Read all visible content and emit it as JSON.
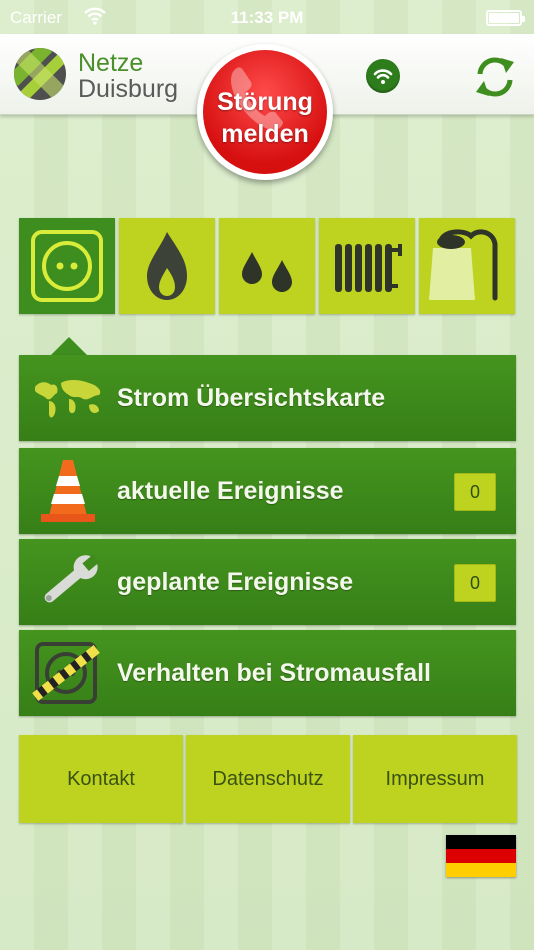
{
  "status_bar": {
    "carrier": "Carrier",
    "time": "11:33 PM",
    "battery_level": 1.0
  },
  "header": {
    "logo": {
      "line1": "Netze",
      "line2": "Duisburg"
    },
    "report_button": {
      "label": "Störung\nmelden",
      "color": "#e21a1a"
    },
    "wifi_icon": "wifi-icon",
    "refresh_icon": "refresh-icon"
  },
  "categories": [
    {
      "id": "strom",
      "icon": "power-socket-icon",
      "selected": true
    },
    {
      "id": "gas",
      "icon": "flame-icon",
      "selected": false
    },
    {
      "id": "wasser",
      "icon": "water-drops-icon",
      "selected": false
    },
    {
      "id": "fernwaerme",
      "icon": "radiator-icon",
      "selected": false
    },
    {
      "id": "strassenbeleuchtung",
      "icon": "street-lamp-icon",
      "selected": false
    }
  ],
  "menu": {
    "map": {
      "label": "Strom Übersichtskarte",
      "icon": "world-map-icon"
    },
    "current": {
      "label": "aktuelle Ereignisse",
      "count": "0",
      "icon": "traffic-cone-icon"
    },
    "planned": {
      "label": "geplante Ereignisse",
      "count": "0",
      "icon": "wrench-icon"
    },
    "behaviour": {
      "label": "Verhalten bei Stromausfall",
      "icon": "blocked-socket-icon"
    }
  },
  "footer": {
    "contact": "Kontakt",
    "privacy": "Datenschutz",
    "imprint": "Impressum"
  },
  "language_icon": "german-flag-icon",
  "colors": {
    "primary_green": "#3e8d1f",
    "lime": "#bdd31f",
    "alert_red": "#e21a1a"
  }
}
